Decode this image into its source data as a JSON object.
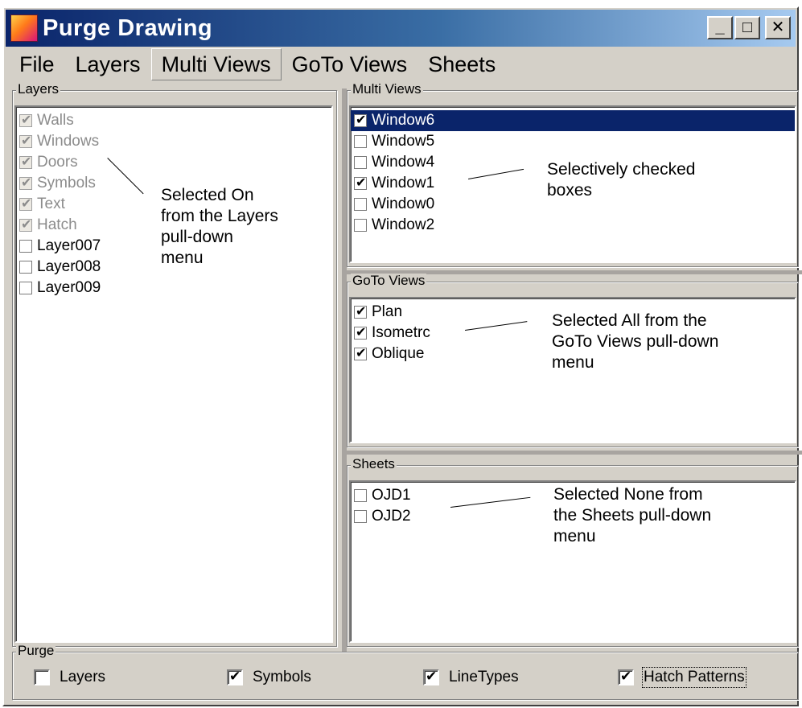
{
  "window": {
    "title": "Purge Drawing",
    "minimize_label": "_",
    "maximize_label": "□",
    "close_label": "✕"
  },
  "menu": {
    "items": [
      "File",
      "Layers",
      "Multi Views",
      "GoTo Views",
      "Sheets"
    ],
    "active": "Multi Views"
  },
  "layers": {
    "label": "Layers",
    "items": [
      {
        "label": "Walls",
        "checked": true,
        "disabled": true
      },
      {
        "label": "Windows",
        "checked": true,
        "disabled": true
      },
      {
        "label": "Doors",
        "checked": true,
        "disabled": true
      },
      {
        "label": "Symbols",
        "checked": true,
        "disabled": true
      },
      {
        "label": "Text",
        "checked": true,
        "disabled": true
      },
      {
        "label": "Hatch",
        "checked": true,
        "disabled": true
      },
      {
        "label": "Layer007",
        "checked": false,
        "disabled": false
      },
      {
        "label": "Layer008",
        "checked": false,
        "disabled": false
      },
      {
        "label": "Layer009",
        "checked": false,
        "disabled": false
      }
    ],
    "annotation": "Selected On\nfrom the Layers\npull-down\nmenu"
  },
  "multi_views": {
    "label": "Multi Views",
    "items": [
      {
        "label": "Window6",
        "checked": true,
        "selected": true
      },
      {
        "label": "Window5",
        "checked": false
      },
      {
        "label": "Window4",
        "checked": false
      },
      {
        "label": "Window1",
        "checked": true
      },
      {
        "label": "Window0",
        "checked": false
      },
      {
        "label": "Window2",
        "checked": false
      }
    ],
    "annotation": "Selectively checked\nboxes"
  },
  "goto_views": {
    "label": "GoTo Views",
    "items": [
      {
        "label": "Plan",
        "checked": true
      },
      {
        "label": "Isometrc",
        "checked": true
      },
      {
        "label": "Oblique",
        "checked": true
      }
    ],
    "annotation": "Selected All from the\nGoTo Views pull-down\nmenu"
  },
  "sheets": {
    "label": "Sheets",
    "items": [
      {
        "label": "OJD1",
        "checked": false
      },
      {
        "label": "OJD2",
        "checked": false
      }
    ],
    "annotation": "Selected None from\nthe Sheets pull-down\nmenu"
  },
  "purge": {
    "label": "Purge",
    "options": [
      {
        "label": "Layers",
        "checked": false
      },
      {
        "label": "Symbols",
        "checked": true
      },
      {
        "label": "LineTypes",
        "checked": true
      },
      {
        "label": "Hatch Patterns",
        "checked": true,
        "focused": true
      }
    ]
  },
  "colors": {
    "face": "#d4d0c8",
    "title_active": "#0a246a",
    "selection": "#0a246a",
    "disabled_text": "#8c8c8c"
  }
}
